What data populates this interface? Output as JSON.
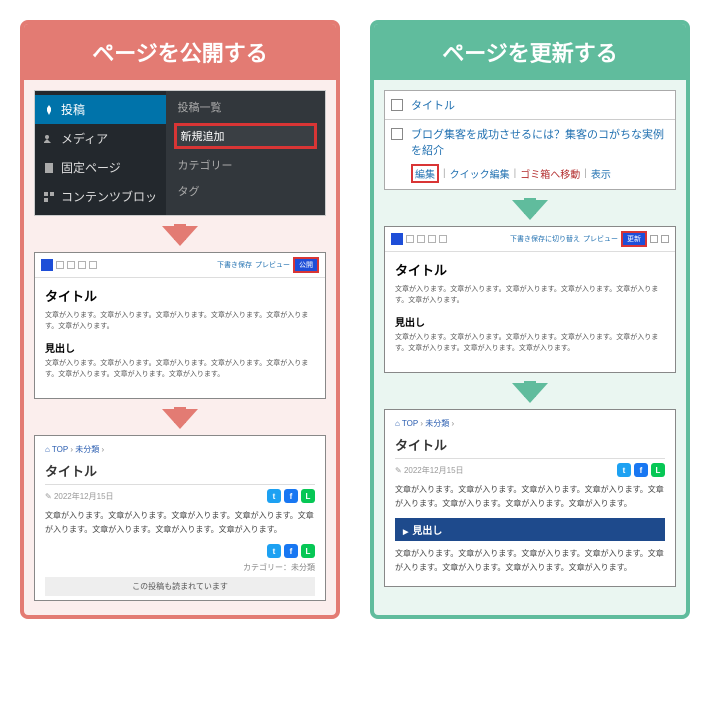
{
  "publish": {
    "header": "ページを公開する",
    "sidebar": {
      "items": [
        {
          "icon": "pin",
          "label": "投稿",
          "active": true
        },
        {
          "icon": "media",
          "label": "メディア"
        },
        {
          "icon": "page",
          "label": "固定ページ"
        },
        {
          "icon": "block",
          "label": "コンテンツブロッ"
        }
      ],
      "submenu": [
        "投稿一覧",
        "新規追加",
        "カテゴリー",
        "タグ"
      ],
      "highlight_index": 1
    },
    "editor": {
      "draft_label": "下書き保存",
      "preview_label": "プレビュー",
      "publish_button": "公開",
      "title": "タイトル",
      "body": "文章が入ります。文章が入ります。文章が入ります。文章が入ります。文章が入ります。文章が入ります。",
      "h2": "見出し",
      "body2": "文章が入ります。文章が入ります。文章が入ります。文章が入ります。文章が入ります。文章が入ります。文章が入ります。文章が入ります。"
    },
    "front": {
      "crumb_home": "TOP",
      "crumb_cat": "未分類",
      "title": "タイトル",
      "date": "2022年12月15日",
      "text": "文章が入ります。文章が入ります。文章が入ります。文章が入ります。文章が入ります。文章が入ります。文章が入ります。文章が入ります。",
      "category_label": "カテゴリー：",
      "category": "未分類",
      "notice": "この投稿も読まれています"
    }
  },
  "update": {
    "header": "ページを更新する",
    "list": {
      "title_col": "タイトル",
      "post_title": "ブログ集客を成功させるには？集客のコがちな実例を紹介",
      "actions": {
        "edit": "編集",
        "quickedit": "クイック編集",
        "trash": "ゴミ箱へ移動",
        "view": "表示"
      }
    },
    "editor": {
      "draft_label": "下書き保存に切り替え",
      "preview_label": "プレビュー",
      "update_button": "更新",
      "title": "タイトル",
      "body": "文章が入ります。文章が入ります。文章が入ります。文章が入ります。文章が入ります。文章が入ります。",
      "h2": "見出し",
      "body2": "文章が入ります。文章が入ります。文章が入ります。文章が入ります。文章が入ります。文章が入ります。文章が入ります。文章が入ります。"
    },
    "front": {
      "crumb_home": "TOP",
      "crumb_cat": "未分類",
      "title": "タイトル",
      "date": "2022年12月15日",
      "text": "文章が入ります。文章が入ります。文章が入ります。文章が入ります。文章が入ります。文章が入ります。文章が入ります。文章が入ります。",
      "h2": "見出し",
      "text2": "文章が入ります。文章が入ります。文章が入ります。文章が入ります。文章が入ります。文章が入ります。文章が入ります。文章が入ります。"
    }
  }
}
